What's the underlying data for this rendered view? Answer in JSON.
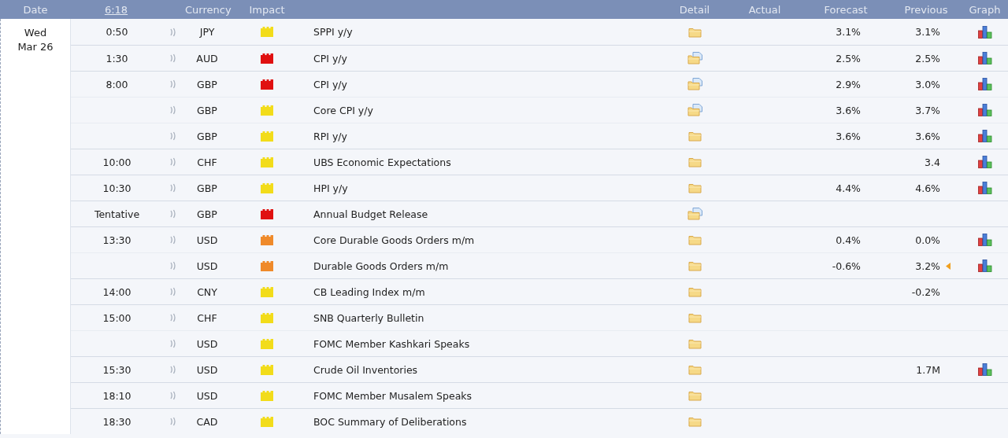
{
  "header": {
    "date": "Date",
    "time": "6:18",
    "currency": "Currency",
    "impact": "Impact",
    "detail": "Detail",
    "actual": "Actual",
    "forecast": "Forecast",
    "previous": "Previous",
    "graph": "Graph"
  },
  "day": {
    "weekday": "Wed",
    "date": "Mar 26"
  },
  "rows": [
    {
      "time": "0:50",
      "currency": "JPY",
      "color": "#f2dc1a",
      "event": "SPPI y/y",
      "document": false,
      "forecast": "3.1%",
      "previous": "3.1%",
      "revised": false,
      "graph": true
    },
    {
      "time": "1:30",
      "currency": "AUD",
      "color": "#e01010",
      "event": "CPI y/y",
      "document": true,
      "forecast": "2.5%",
      "previous": "2.5%",
      "revised": false,
      "graph": true
    },
    {
      "time": "8:00",
      "currency": "GBP",
      "color": "#e01010",
      "event": "CPI y/y",
      "document": true,
      "forecast": "2.9%",
      "previous": "3.0%",
      "revised": false,
      "graph": true
    },
    {
      "currency": "GBP",
      "color": "#f2dc1a",
      "event": "Core CPI y/y",
      "document": true,
      "forecast": "3.6%",
      "previous": "3.7%",
      "revised": false,
      "graph": true
    },
    {
      "currency": "GBP",
      "color": "#f2dc1a",
      "event": "RPI y/y",
      "document": false,
      "forecast": "3.6%",
      "previous": "3.6%",
      "revised": false,
      "graph": true
    },
    {
      "time": "10:00",
      "currency": "CHF",
      "color": "#f2dc1a",
      "event": "UBS Economic Expectations",
      "document": false,
      "previous": "3.4",
      "revised": false,
      "graph": true
    },
    {
      "time": "10:30",
      "currency": "GBP",
      "color": "#f2dc1a",
      "event": "HPI y/y",
      "document": false,
      "forecast": "4.4%",
      "previous": "4.6%",
      "revised": false,
      "graph": true
    },
    {
      "time": "Tentative",
      "currency": "GBP",
      "color": "#e01010",
      "event": "Annual Budget Release",
      "document": true,
      "revised": false,
      "graph": false
    },
    {
      "time": "13:30",
      "currency": "USD",
      "color": "#ef8a2a",
      "event": "Core Durable Goods Orders m/m",
      "document": false,
      "forecast": "0.4%",
      "previous": "0.0%",
      "revised": false,
      "graph": true
    },
    {
      "currency": "USD",
      "color": "#ef8a2a",
      "event": "Durable Goods Orders m/m",
      "document": false,
      "forecast": "-0.6%",
      "previous": "3.2%",
      "revised": true,
      "graph": true
    },
    {
      "time": "14:00",
      "currency": "CNY",
      "color": "#f2dc1a",
      "event": "CB Leading Index m/m",
      "document": false,
      "previous": "-0.2%",
      "revised": false,
      "graph": false
    },
    {
      "time": "15:00",
      "currency": "CHF",
      "color": "#f2dc1a",
      "event": "SNB Quarterly Bulletin",
      "document": false,
      "revised": false,
      "graph": false
    },
    {
      "currency": "USD",
      "color": "#f2dc1a",
      "event": "FOMC Member Kashkari Speaks",
      "document": false,
      "revised": false,
      "graph": false
    },
    {
      "time": "15:30",
      "currency": "USD",
      "color": "#f2dc1a",
      "event": "Crude Oil Inventories",
      "document": false,
      "previous": "1.7M",
      "revised": false,
      "graph": true
    },
    {
      "time": "18:10",
      "currency": "USD",
      "color": "#f2dc1a",
      "event": "FOMC Member Musalem Speaks",
      "document": false,
      "revised": false,
      "graph": false
    },
    {
      "time": "18:30",
      "currency": "CAD",
      "color": "#f2dc1a",
      "event": "BOC Summary of Deliberations",
      "document": false,
      "revised": false,
      "graph": false
    }
  ]
}
